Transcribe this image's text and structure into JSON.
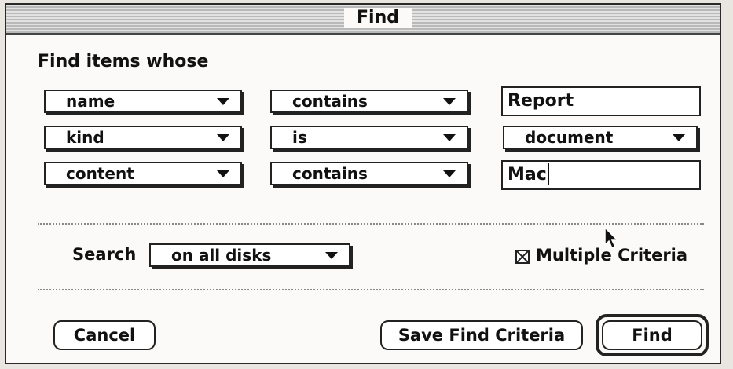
{
  "window": {
    "title": "Find"
  },
  "heading": "Find items whose",
  "criteria": [
    {
      "attribute": "name",
      "operator": "contains",
      "value": "Report",
      "value_type": "text"
    },
    {
      "attribute": "kind",
      "operator": "is",
      "value": "document",
      "value_type": "popup"
    },
    {
      "attribute": "content",
      "operator": "contains",
      "value": "Mac",
      "value_type": "text"
    }
  ],
  "search": {
    "label": "Search",
    "scope": "on all disks"
  },
  "multiple_criteria": {
    "label": "Multiple Criteria",
    "checked": true
  },
  "buttons": {
    "cancel": "Cancel",
    "save": "Save Find Criteria",
    "find": "Find"
  }
}
